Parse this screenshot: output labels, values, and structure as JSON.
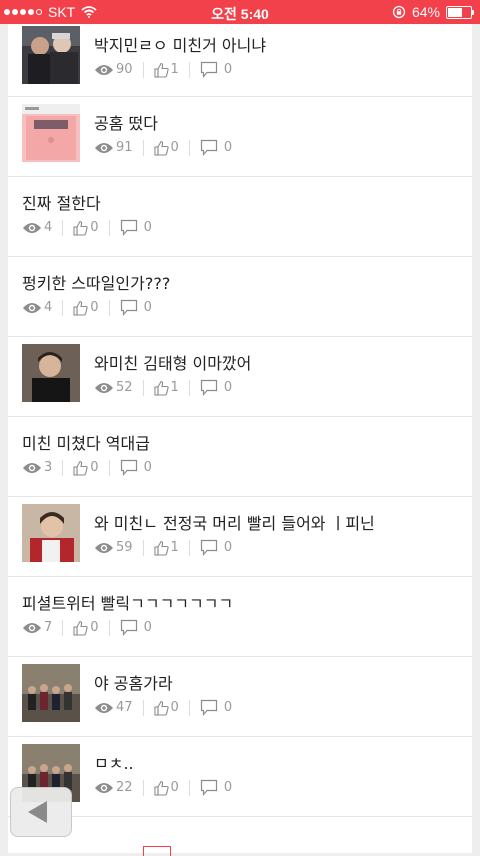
{
  "status_bar": {
    "carrier": "SKT",
    "time": "오전 5:40",
    "battery": "64%",
    "battery_level": 0.64
  },
  "posts": [
    {
      "title": "박지민ㄹㅇ 미친거 아니냐",
      "views": "90",
      "likes": "1",
      "comments": "0",
      "thumbnail": "group-photo-dark"
    },
    {
      "title": "공홈 떴다",
      "views": "91",
      "likes": "0",
      "comments": "0",
      "thumbnail": "pink-webpage"
    },
    {
      "title": "진짜 절한다",
      "views": "4",
      "likes": "0",
      "comments": "0",
      "thumbnail": ""
    },
    {
      "title": "펑키한 스따일인가???",
      "views": "4",
      "likes": "0",
      "comments": "0",
      "thumbnail": ""
    },
    {
      "title": "와미친 김태형 이마깠어",
      "views": "52",
      "likes": "1",
      "comments": "0",
      "thumbnail": "portrait-dark"
    },
    {
      "title": "미친 미쳤다 역대급",
      "views": "3",
      "likes": "0",
      "comments": "0",
      "thumbnail": ""
    },
    {
      "title": "와 미친ㄴ 전정국 머리 빨리 들어와 ㅣ피닌",
      "views": "59",
      "likes": "1",
      "comments": "0",
      "thumbnail": "portrait-red"
    },
    {
      "title": "피셜트위터 빨릭ㄱㄱㄱㄱㄱㄱㄱ",
      "views": "7",
      "likes": "0",
      "comments": "0",
      "thumbnail": ""
    },
    {
      "title": "야 공홈가라",
      "views": "47",
      "likes": "0",
      "comments": "0",
      "thumbnail": "group-photo-street"
    },
    {
      "title": "ㅁㅊ..",
      "views": "22",
      "likes": "0",
      "comments": "0",
      "thumbnail": "group-photo-street"
    }
  ],
  "icons": {
    "views": "eye-icon",
    "likes": "thumbs-up-icon",
    "comments": "comment-icon",
    "back": "back-arrow-icon"
  },
  "colors": {
    "accent": "#f2414b",
    "meta_text": "#9a9a9a"
  }
}
